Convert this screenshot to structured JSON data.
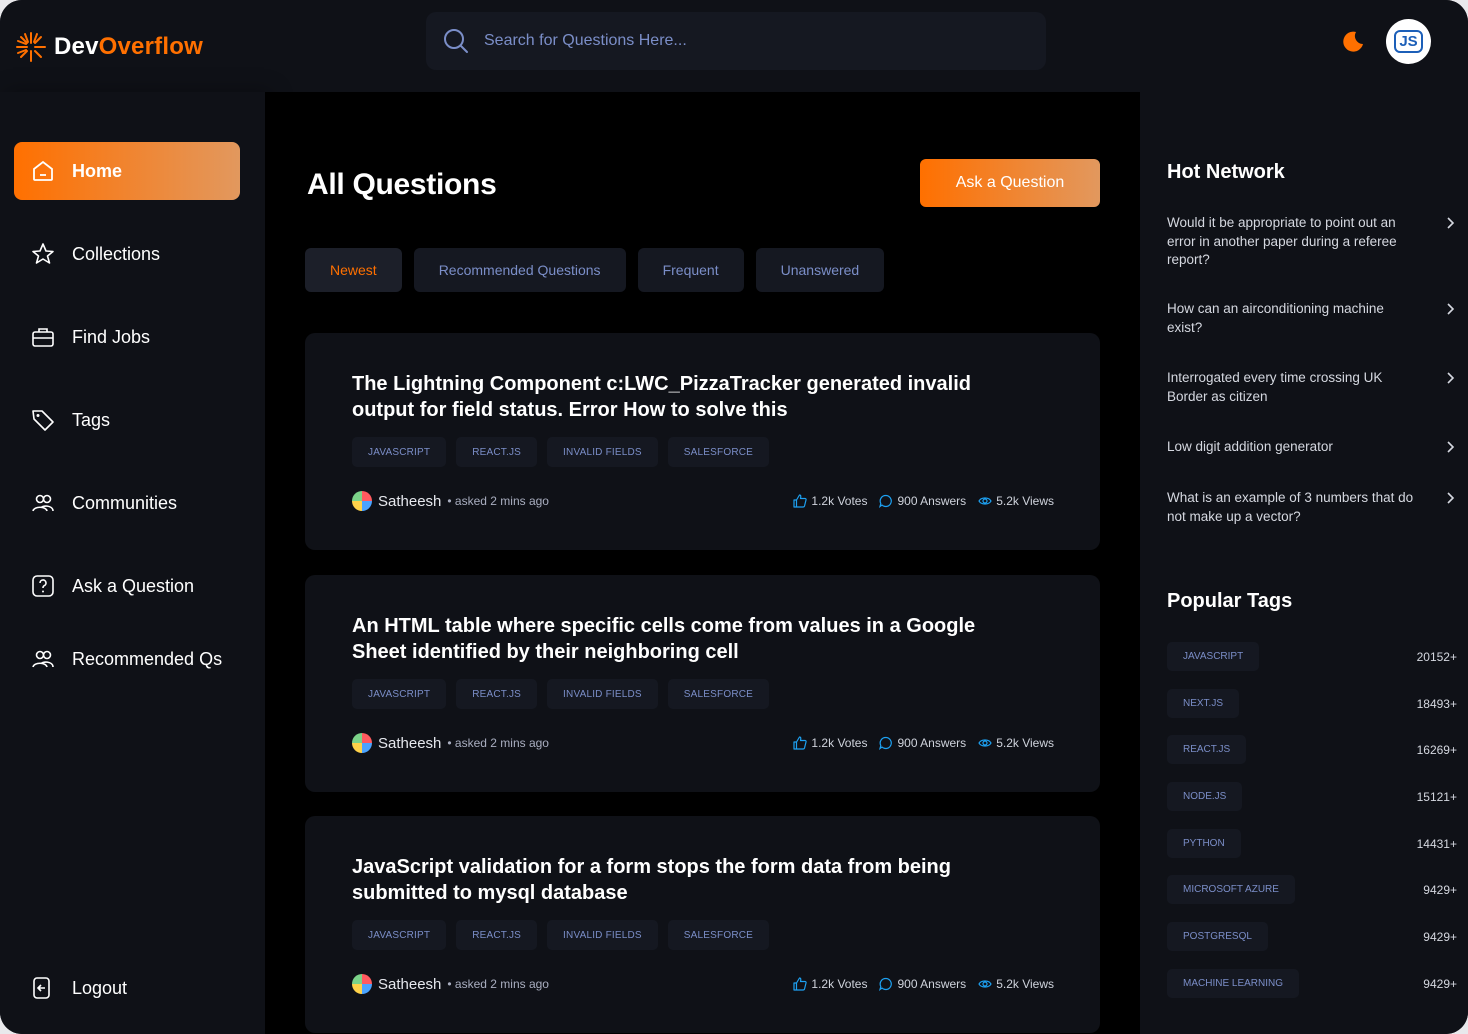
{
  "brand": {
    "name_a": "Dev",
    "name_b": "Overflow",
    "accent": "#ff7000"
  },
  "search": {
    "placeholder": "Search for Questions Here..."
  },
  "user": {
    "avatar_text": "JS"
  },
  "sidebar": {
    "items": [
      {
        "label": "Home",
        "icon": "home-icon",
        "active": true
      },
      {
        "label": "Collections",
        "icon": "star-icon"
      },
      {
        "label": "Find Jobs",
        "icon": "briefcase-icon"
      },
      {
        "label": "Tags",
        "icon": "tag-icon"
      },
      {
        "label": "Communities",
        "icon": "users-icon"
      },
      {
        "label": "Ask a Question",
        "icon": "question-icon"
      },
      {
        "label": "Recommended Qs",
        "icon": "users-icon"
      }
    ],
    "logout": "Logout"
  },
  "main": {
    "title": "All Questions",
    "ask_button": "Ask a Question",
    "filters": [
      "Newest",
      "Recommended Questions",
      "Frequent",
      "Unanswered"
    ],
    "questions": [
      {
        "title": "The Lightning Component c:LWC_PizzaTracker generated invalid output for field status. Error How to solve this",
        "tags": [
          "javascript",
          "react.js",
          "invalid fields",
          "salesforce"
        ],
        "author": "Satheesh",
        "asked": "• asked 2 mins ago",
        "votes": "1.2k Votes",
        "answers": "900 Answers",
        "views": "5.2k Views"
      },
      {
        "title": "An HTML table where specific cells come from values in a Google Sheet identified by their neighboring cell",
        "tags": [
          "javascript",
          "react.js",
          "invalid fields",
          "salesforce"
        ],
        "author": "Satheesh",
        "asked": "• asked 2 mins ago",
        "votes": "1.2k Votes",
        "answers": "900 Answers",
        "views": "5.2k Views"
      },
      {
        "title": "JavaScript validation for a form stops the form data from being submitted to mysql database",
        "tags": [
          "javascript",
          "react.js",
          "invalid fields",
          "salesforce"
        ],
        "author": "Satheesh",
        "asked": "• asked 2 mins ago",
        "votes": "1.2k Votes",
        "answers": "900 Answers",
        "views": "5.2k Views"
      }
    ]
  },
  "rightbar": {
    "hot_title": "Hot Network",
    "hot": [
      "Would it be appropriate to point out an error in another paper during a referee report?",
      "How can an airconditioning machine exist?",
      "Interrogated every time crossing UK Border as citizen",
      "Low digit addition generator",
      "What is an example of 3 numbers that do not make up a vector?"
    ],
    "tags_title": "Popular Tags",
    "tags": [
      {
        "name": "javascript",
        "count": "20152+"
      },
      {
        "name": "next.js",
        "count": "18493+"
      },
      {
        "name": "react.js",
        "count": "16269+"
      },
      {
        "name": "node.js",
        "count": "15121+"
      },
      {
        "name": "python",
        "count": "14431+"
      },
      {
        "name": "microsoft azure",
        "count": "9429+"
      },
      {
        "name": "postgresql",
        "count": "9429+"
      },
      {
        "name": "machine learning",
        "count": "9429+"
      }
    ]
  }
}
